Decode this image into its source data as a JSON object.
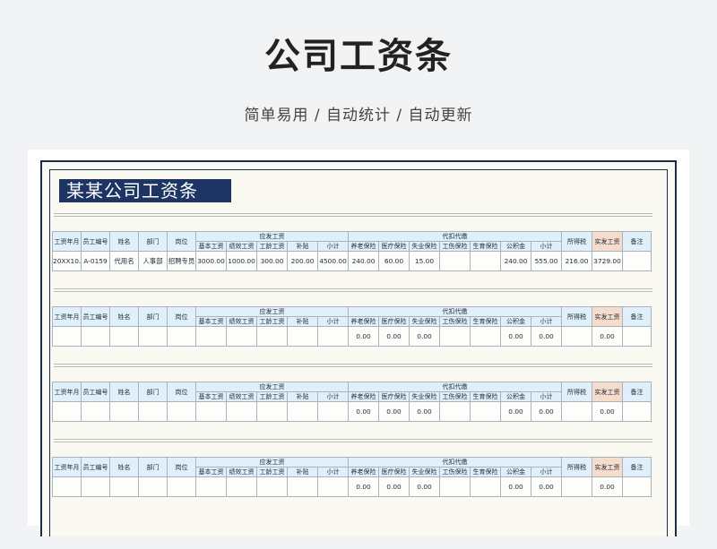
{
  "page": {
    "title": "公司工资条",
    "subtitle": "简单易用 / 自动统计 / 自动更新"
  },
  "sheet": {
    "heading": "某某公司工资条"
  },
  "headers": {
    "month": "工资年月",
    "emp_id": "员工编号",
    "name": "姓名",
    "dept": "部门",
    "position": "岗位",
    "payable_group": "应发工资",
    "base": "基本工资",
    "performance": "绩效工资",
    "seniority": "工龄工资",
    "subsidy": "补贴",
    "payable_subtotal": "小计",
    "deduct_group": "代扣代缴",
    "pension": "养老保险",
    "medical": "医疗保险",
    "unemployment": "失业保险",
    "injury": "工伤保险",
    "maternity": "生育保险",
    "housing_fund": "公积金",
    "deduct_subtotal": "小计",
    "income_tax": "所得税",
    "net_pay": "实发工资",
    "remark": "备注"
  },
  "slips": [
    {
      "month": "20XX10.0",
      "emp_id": "A-0159",
      "name": "代用名",
      "dept": "人事部",
      "position": "招聘专员",
      "base": "3000.00",
      "performance": "1000.00",
      "seniority": "300.00",
      "subsidy": "200.00",
      "payable_subtotal": "4500.00",
      "pension": "240.00",
      "medical": "60.00",
      "unemployment": "15.00",
      "injury": "",
      "maternity": "",
      "housing_fund": "240.00",
      "deduct_subtotal": "555.00",
      "income_tax": "216.00",
      "net_pay": "3729.00",
      "remark": ""
    },
    {
      "month": "",
      "emp_id": "",
      "name": "",
      "dept": "",
      "position": "",
      "base": "",
      "performance": "",
      "seniority": "",
      "subsidy": "",
      "payable_subtotal": "",
      "pension": "0.00",
      "medical": "0.00",
      "unemployment": "0.00",
      "injury": "",
      "maternity": "",
      "housing_fund": "0.00",
      "deduct_subtotal": "0.00",
      "income_tax": "",
      "net_pay": "0.00",
      "remark": ""
    },
    {
      "month": "",
      "emp_id": "",
      "name": "",
      "dept": "",
      "position": "",
      "base": "",
      "performance": "",
      "seniority": "",
      "subsidy": "",
      "payable_subtotal": "",
      "pension": "0.00",
      "medical": "0.00",
      "unemployment": "0.00",
      "injury": "",
      "maternity": "",
      "housing_fund": "0.00",
      "deduct_subtotal": "0.00",
      "income_tax": "",
      "net_pay": "0.00",
      "remark": ""
    },
    {
      "month": "",
      "emp_id": "",
      "name": "",
      "dept": "",
      "position": "",
      "base": "",
      "performance": "",
      "seniority": "",
      "subsidy": "",
      "payable_subtotal": "",
      "pension": "0.00",
      "medical": "0.00",
      "unemployment": "0.00",
      "injury": "",
      "maternity": "",
      "housing_fund": "0.00",
      "deduct_subtotal": "0.00",
      "income_tax": "",
      "net_pay": "0.00",
      "remark": ""
    }
  ]
}
